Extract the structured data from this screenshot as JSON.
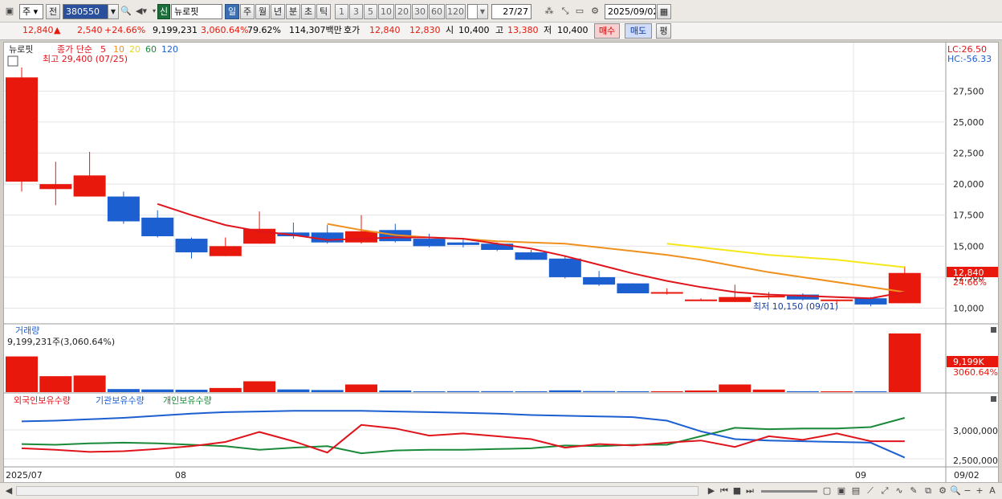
{
  "toolbar": {
    "period_select": "주",
    "prev_label": "전",
    "code": "380550",
    "market_badge": "신",
    "name": "뉴로핏",
    "periods": [
      "일",
      "주",
      "월",
      "년",
      "분",
      "초",
      "틱"
    ],
    "active_period": "일",
    "intervals": [
      "1",
      "3",
      "5",
      "10",
      "20",
      "30",
      "60",
      "120"
    ],
    "page_counter": "27/27",
    "date": "2025/09/02"
  },
  "quote": {
    "price": "12,840",
    "arrow": "▲",
    "change": "2,540",
    "change_pct": "+24.66%",
    "volume": "9,199,231",
    "vol_ratio": "3,060.64%",
    "turnover": "79.62%",
    "amount": "114,307백만",
    "ask_label": "호가",
    "ask": "12,840",
    "bid": "12,830",
    "open_label": "시",
    "open": "10,400",
    "high_label": "고",
    "high": "13,380",
    "low_label": "저",
    "low": "10,400",
    "buy_label": "매수",
    "sell_label": "매도",
    "avg_label": "평"
  },
  "chart": {
    "stock_name": "뉴로핏",
    "ma_title": "종가 단순",
    "ma_periods": [
      "5",
      "10",
      "20",
      "60",
      "120"
    ],
    "high_note": "최고 29,400 (07/25)",
    "low_note": "최저 10,150 (09/01)",
    "lc": "LC:26.50",
    "hc": "HC:-56.33",
    "y_ticks": [
      "27,500",
      "25,000",
      "22,500",
      "20,000",
      "17,500",
      "15,000",
      "12,500",
      "10,000"
    ],
    "current_price": "12,840",
    "current_pct": "24.66%",
    "volume_title": "거래량",
    "volume_note": "9,199,231주(3,060.64%)",
    "vol_right_1": "9,199K",
    "vol_right_2": "3060.64%",
    "vol_right_hidden": "9,199K",
    "holdings_foreign": "외국인보유수량",
    "holdings_inst": "기관보유수량",
    "holdings_indiv": "개인보유수량",
    "hold_ticks": [
      "3,000,000",
      "2,500,000"
    ],
    "x_labels": [
      "2025/07",
      "08",
      "09",
      "09/02"
    ]
  },
  "colors": {
    "up": "#e8180c",
    "down": "#1c5fd0",
    "ma5": "#e0141c",
    "ma10": "#f0901c",
    "ma20": "#f4e818",
    "ma60": "#1a8a3a",
    "ma120": "#1c5fd0"
  },
  "chart_data": {
    "type": "candlestick",
    "dates_label": [
      "2025/07",
      "08",
      "09",
      "09/02"
    ],
    "candles": [
      {
        "open": 20200,
        "high": 29400,
        "low": 19400,
        "close": 28600
      },
      {
        "open": 19600,
        "high": 21800,
        "low": 18300,
        "close": 20000
      },
      {
        "open": 19000,
        "high": 22600,
        "low": 19000,
        "close": 20700
      },
      {
        "open": 19000,
        "high": 19400,
        "low": 16800,
        "close": 17000
      },
      {
        "open": 17300,
        "high": 17900,
        "low": 15700,
        "close": 15800
      },
      {
        "open": 15600,
        "high": 15700,
        "low": 14000,
        "close": 14500
      },
      {
        "open": 14200,
        "high": 15700,
        "low": 14200,
        "close": 15000
      },
      {
        "open": 15200,
        "high": 17800,
        "low": 15200,
        "close": 16400
      },
      {
        "open": 16100,
        "high": 16900,
        "low": 15600,
        "close": 15800
      },
      {
        "open": 16100,
        "high": 16700,
        "low": 15200,
        "close": 15300
      },
      {
        "open": 15300,
        "high": 17500,
        "low": 15200,
        "close": 16200
      },
      {
        "open": 16300,
        "high": 16800,
        "low": 15300,
        "close": 15400
      },
      {
        "open": 15600,
        "high": 16000,
        "low": 14900,
        "close": 15000
      },
      {
        "open": 15300,
        "high": 15600,
        "low": 14900,
        "close": 15100
      },
      {
        "open": 15200,
        "high": 15300,
        "low": 14600,
        "close": 14700
      },
      {
        "open": 14500,
        "high": 14700,
        "low": 13900,
        "close": 13900
      },
      {
        "open": 14000,
        "high": 14200,
        "low": 12400,
        "close": 12500
      },
      {
        "open": 12500,
        "high": 13000,
        "low": 11800,
        "close": 11900
      },
      {
        "open": 12000,
        "high": 12000,
        "low": 11200,
        "close": 11200
      },
      {
        "open": 11200,
        "high": 11600,
        "low": 11100,
        "close": 11300
      },
      {
        "open": 10700,
        "high": 10800,
        "low": 10650,
        "close": 10700
      },
      {
        "open": 10500,
        "high": 11900,
        "low": 10500,
        "close": 10900
      },
      {
        "open": 11000,
        "high": 11300,
        "low": 10700,
        "close": 11000
      },
      {
        "open": 11100,
        "high": 11200,
        "low": 10600,
        "close": 10700
      },
      {
        "open": 10600,
        "high": 10700,
        "low": 10300,
        "close": 10700
      },
      {
        "open": 10800,
        "high": 10900,
        "low": 10150,
        "close": 10300
      },
      {
        "open": 10400,
        "high": 13380,
        "low": 10400,
        "close": 12840
      }
    ],
    "ma5": [
      null,
      null,
      null,
      null,
      18400,
      17500,
      16700,
      16200,
      15900,
      15500,
      15600,
      15700,
      15700,
      15600,
      15200,
      14800,
      14200,
      13500,
      12800,
      12200,
      11700,
      11300,
      11100,
      11000,
      10900,
      10800,
      11300
    ],
    "ma10": [
      null,
      null,
      null,
      null,
      null,
      null,
      null,
      null,
      null,
      16800,
      16300,
      15900,
      15700,
      15600,
      15400,
      15300,
      15200,
      14900,
      14600,
      14300,
      13900,
      13400,
      12900,
      12500,
      12100,
      11700,
      11300
    ],
    "ma20": [
      null,
      null,
      null,
      null,
      null,
      null,
      null,
      null,
      null,
      null,
      null,
      null,
      null,
      null,
      null,
      null,
      null,
      null,
      null,
      15200,
      14900,
      14600,
      14300,
      14100,
      13900,
      13600,
      13300
    ],
    "volume": [
      5600000,
      2500000,
      2600000,
      480000,
      420000,
      380000,
      650000,
      1700000,
      420000,
      330000,
      1200000,
      260000,
      130000,
      150000,
      150000,
      130000,
      280000,
      160000,
      140000,
      140000,
      260000,
      1200000,
      400000,
      140000,
      130000,
      120000,
      9199231
    ],
    "holdings": {
      "foreign": [
        2550000,
        2530000,
        2500000,
        2510000,
        2540000,
        2580000,
        2640000,
        2780000,
        2650000,
        2490000,
        2880000,
        2830000,
        2730000,
        2760000,
        2720000,
        2680000,
        2560000,
        2610000,
        2590000,
        2630000,
        2660000,
        2570000,
        2720000,
        2670000,
        2760000,
        2650000,
        2650000
      ],
      "inst": [
        2930000,
        2940000,
        2960000,
        2980000,
        3010000,
        3040000,
        3060000,
        3070000,
        3080000,
        3080000,
        3080000,
        3070000,
        3060000,
        3050000,
        3040000,
        3020000,
        3010000,
        3000000,
        2990000,
        2940000,
        2790000,
        2680000,
        2660000,
        2650000,
        2640000,
        2630000,
        2420000
      ],
      "indiv": [
        2610000,
        2600000,
        2620000,
        2630000,
        2620000,
        2600000,
        2580000,
        2530000,
        2560000,
        2580000,
        2480000,
        2520000,
        2530000,
        2530000,
        2540000,
        2550000,
        2590000,
        2580000,
        2600000,
        2600000,
        2720000,
        2840000,
        2820000,
        2830000,
        2830000,
        2850000,
        2980000
      ]
    },
    "ylim": [
      9000,
      30500
    ],
    "holdings_ylim": [
      2300000,
      3150000
    ]
  }
}
